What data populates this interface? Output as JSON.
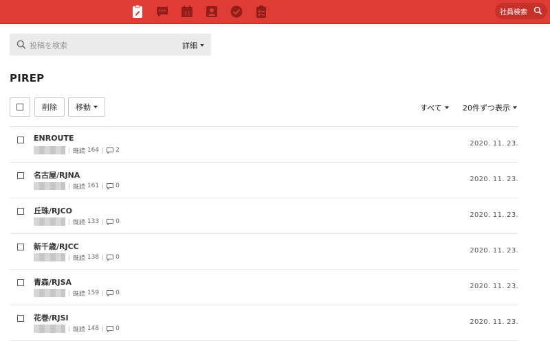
{
  "topbar": {
    "apps": [
      {
        "name": "board-icon",
        "label": ""
      },
      {
        "name": "message-icon",
        "label": ""
      },
      {
        "name": "calendar-icon",
        "label": "31"
      },
      {
        "name": "contacts-icon",
        "label": ""
      },
      {
        "name": "todo-icon",
        "label": ""
      },
      {
        "name": "task-icon",
        "label": ""
      }
    ],
    "employee_search": "社員検索"
  },
  "search": {
    "placeholder": "投稿を検索",
    "detail_label": "詳細"
  },
  "page": {
    "title": "PIREP"
  },
  "toolbar": {
    "delete_label": "削除",
    "move_label": "移動",
    "filter_label": "すべて",
    "per_page_label": "20件ずつ表示"
  },
  "posts": [
    {
      "title": "ENROUTE",
      "read_label": "既読",
      "read_count": "164",
      "comments": "2",
      "date": "2020. 11. 23."
    },
    {
      "title": "名古屋/RJNA",
      "read_label": "既読",
      "read_count": "161",
      "comments": "0",
      "date": "2020. 11. 23."
    },
    {
      "title": "丘珠/RJCO",
      "read_label": "既読",
      "read_count": "133",
      "comments": "0",
      "date": "2020. 11. 23."
    },
    {
      "title": "新千歳/RJCC",
      "read_label": "既読",
      "read_count": "138",
      "comments": "0",
      "date": "2020. 11. 23."
    },
    {
      "title": "青森/RJSA",
      "read_label": "既読",
      "read_count": "159",
      "comments": "0",
      "date": "2020. 11. 23."
    },
    {
      "title": "花巻/RJSI",
      "read_label": "既読",
      "read_count": "148",
      "comments": "0",
      "date": "2020. 11. 23."
    }
  ],
  "colors": {
    "brand": "#e03b34",
    "brand_dark": "#c83129"
  }
}
